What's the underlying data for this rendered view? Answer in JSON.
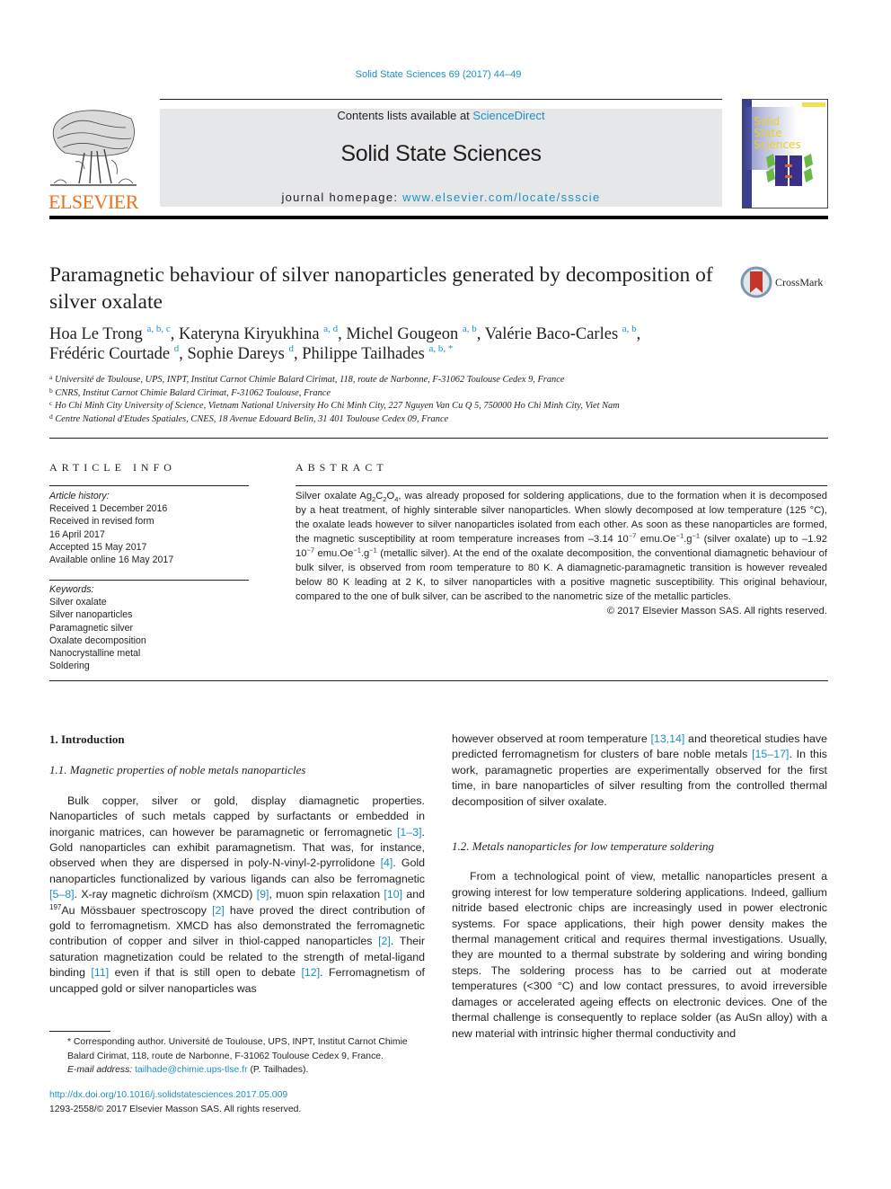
{
  "header": {
    "citation": "Solid State Sciences 69 (2017) 44–49",
    "contents_prefix": "Contents lists available at ",
    "contents_link": "ScienceDirect",
    "journal_name": "Solid State Sciences",
    "homepage_prefix": "journal homepage: ",
    "homepage_url": "www.elsevier.com/locate/ssscie",
    "publisher_logo": "ELSEVIER",
    "cover_title_lines": [
      "Solid",
      "State",
      "Sciences"
    ]
  },
  "article": {
    "title": "Paramagnetic behaviour of silver nanoparticles generated by decomposition of silver oxalate",
    "crossmark_label": "CrossMark",
    "authors": [
      {
        "name": "Hoa Le Trong",
        "affil": "a, b, c",
        "sep": ", "
      },
      {
        "name": "Kateryna Kiryukhina",
        "affil": "a, d",
        "sep": ", "
      },
      {
        "name": "Michel Gougeon",
        "affil": "a, b",
        "sep": ", "
      },
      {
        "name": "Valérie Baco-Carles",
        "affil": "a, b",
        "sep": ","
      },
      {
        "name": "Frédéric Courtade",
        "affil": "d",
        "sep": ", "
      },
      {
        "name": "Sophie Dareys",
        "affil": "d",
        "sep": ", "
      },
      {
        "name": "Philippe Tailhades",
        "affil": "a, b, *",
        "sep": ""
      }
    ],
    "affiliations": [
      {
        "key": "a",
        "text": "Université de Toulouse, UPS, INPT, Institut Carnot Chimie Balard Cirimat, 118, route de Narbonne, F-31062 Toulouse Cedex 9, France"
      },
      {
        "key": "b",
        "text": "CNRS, Institut Carnot Chimie Balard Cirimat, F-31062 Toulouse, France"
      },
      {
        "key": "c",
        "text": "Ho Chi Minh City University of Science, Vietnam National University Ho Chi Minh City, 227 Nguyen Van Cu Q 5, 750000 Ho Chi Minh City, Viet Nam"
      },
      {
        "key": "d",
        "text": "Centre National d'Etudes Spatiales, CNES, 18 Avenue Edouard Belin, 31 401 Toulouse Cedex 09, France"
      }
    ]
  },
  "article_info": {
    "heading": "ARTICLE INFO",
    "history_label": "Article history:",
    "history": [
      "Received 1 December 2016",
      "Received in revised form",
      "16 April 2017",
      "Accepted 15 May 2017",
      "Available online 16 May 2017"
    ],
    "keywords_label": "Keywords:",
    "keywords": [
      "Silver oxalate",
      "Silver nanoparticles",
      "Paramagnetic silver",
      "Oxalate decomposition",
      "Nanocrystalline metal",
      "Soldering"
    ]
  },
  "abstract": {
    "heading": "ABSTRACT",
    "p1_a": "Silver oxalate Ag",
    "p1_sub1": "2",
    "p1_b": "C",
    "p1_sub2": "2",
    "p1_c": "O",
    "p1_sub3": "4",
    "p1_d": ", was already proposed for soldering applications, due to the formation when it is decomposed by a heat treatment, of highly sinterable silver nanoparticles. When slowly decomposed at low temperature (125 °C), the oxalate leads however to silver nanoparticles isolated from each other. As soon as these nanoparticles are formed, the magnetic susceptibility at room temperature increases from –3.14 10",
    "exp1": "−7",
    "p1_e": " emu.Oe",
    "exp2": "−1",
    "p1_f": ".g",
    "exp3": "−1",
    "p1_g": " (silver oxalate) up to –1.92 10",
    "exp4": "−7",
    "p1_h": " emu.Oe",
    "exp5": "−1",
    "p1_i": ".g",
    "exp6": "−1",
    "p1_j": " (metallic silver). At the end of the oxalate decomposition, the conventional diamagnetic behaviour of bulk silver, is observed from room temperature to 80 K. A diamagnetic-paramagnetic transition is however revealed below 80 K leading at 2 K, to silver nanoparticles with a positive magnetic susceptibility. This original behaviour, compared to the one of bulk silver, can be ascribed to the nanometric size of the metallic particles.",
    "copyright": "© 2017 Elsevier Masson SAS. All rights reserved."
  },
  "body": {
    "section1_title": "1.  Introduction",
    "sub11_title": "1.1.  Magnetic properties of noble metals nanoparticles",
    "sub11_p": [
      "Bulk copper, silver or gold, display diamagnetic properties. Nanoparticles of such metals capped by surfactants or embedded in inorganic matrices, can however be paramagnetic or ferromagnetic ",
      "[1–3]",
      ". Gold nanoparticles can exhibit paramagnetism. That was, for instance, observed when they are dispersed in poly-N-vinyl-2-pyrrolidone ",
      "[4]",
      ". Gold nanoparticles functionalized by various ligands can also be ferromagnetic ",
      "[5–8]",
      ". X-ray magnetic dichroïsm (XMCD) ",
      "[9]",
      ", muon spin relaxation ",
      "[10]",
      " and ",
      "197",
      "Au Mössbauer spectroscopy ",
      "[2]",
      " have proved the direct contribution of gold to ferromagnetism. XMCD has also demonstrated the ferromagnetic contribution of copper and silver in thiol-capped nanoparticles ",
      "[2]",
      ". Their saturation magnetization could be related to the strength of metal-ligand binding ",
      "[11]",
      " even if that is still open to debate ",
      "[12]",
      ". Ferromagnetism of uncapped gold or silver nanoparticles was"
    ],
    "right_p1": [
      "however observed at room temperature ",
      "[13,14]",
      " and theoretical studies have predicted ferromagnetism for clusters of bare noble metals ",
      "[15–17]",
      ". In this work, paramagnetic properties are experimentally observed for the first time, in bare nanoparticles of silver resulting from the controlled thermal decomposition of silver oxalate."
    ],
    "sub12_title": "1.2.  Metals nanoparticles for low temperature soldering",
    "sub12_p": "From a technological point of view, metallic nanoparticles present a growing interest for low temperature soldering applications. Indeed, gallium nitride based electronic chips are increasingly used in power electronic systems. For space applications, their high power density makes the thermal management critical and requires thermal investigations. Usually, they are mounted to a thermal substrate by soldering and wiring bonding steps. The soldering process has to be carried out at moderate temperatures (<300 °C) and low contact pressures, to avoid irreversible damages or accelerated ageing effects on electronic devices. One of the thermal challenge is consequently to replace solder (as AuSn alloy) with a new material with intrinsic higher thermal conductivity and"
  },
  "footnote": {
    "corresponding": "* Corresponding author. Université de Toulouse, UPS, INPT, Institut Carnot Chimie Balard Cirimat, 118, route de Narbonne, F-31062 Toulouse Cedex 9, France.",
    "email_label": "E-mail address: ",
    "email": "tailhade@chimie.ups-tlse.fr",
    "email_suffix": " (P. Tailhades)."
  },
  "doi": {
    "url": "http://dx.doi.org/10.1016/j.solidstatesciences.2017.05.009",
    "issn_line": "1293-2558/© 2017 Elsevier Masson SAS. All rights reserved."
  },
  "colors": {
    "link": "#1f8fc2",
    "elsevier_orange": "#e9711c",
    "masthead_bg": "#e6e7e8"
  }
}
